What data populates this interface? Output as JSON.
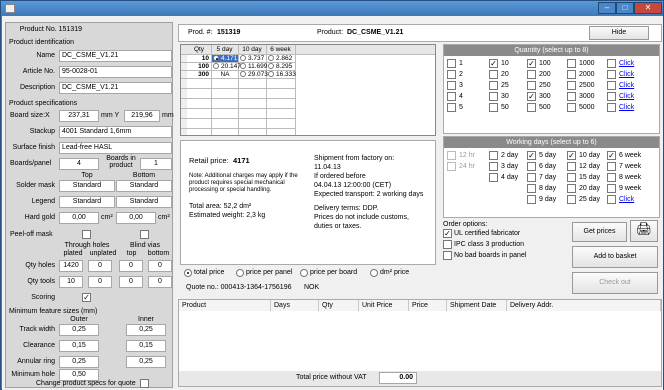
{
  "window": {
    "title": "",
    "min": "–",
    "max": "□",
    "close": "✕"
  },
  "left": {
    "product_no": "Product No. 151319",
    "product_identification": "Product identification",
    "name_label": "Name",
    "name_value": "DC_CSME_V1.21",
    "article_label": "Article No.",
    "article_value": "95-0028-01",
    "description_label": "Description",
    "description_value": "DC_CSME_V1.21",
    "product_specs": "Product specifications",
    "board_size_label": "Board size:X",
    "board_x": "237,31",
    "mm_y": "mm Y",
    "board_y": "219,96",
    "mm": "mm",
    "stackup_label": "Stackup",
    "stackup_value": "4001 Standard 1,6mm",
    "surface_label": "Surface finish",
    "surface_value": "Lead-free HASL",
    "boards_panel_label": "Boards/panel",
    "boards_panel_value": "4",
    "boards_product_label": "Boards in product",
    "boards_product_value": "1",
    "top": "Top",
    "bottom": "Bottom",
    "solder_mask": "Solder mask",
    "solder_top": "Standard",
    "solder_bottom": "Standard",
    "legend": "Legend",
    "legend_top": "Standard",
    "legend_bottom": "Standard",
    "hard_gold": "Hard gold",
    "gold_top": "0,00",
    "gold_bottom": "0,00",
    "cm2": "cm²",
    "peel_off": "Peel-off mask",
    "through_holes": "Through holes",
    "plated": "plated",
    "unplated": "unplated",
    "blind_vias": "Blind vias",
    "b_top": "top",
    "b_bottom": "bottom",
    "qty_holes": "Qty holes",
    "holes_plated": "1420",
    "holes_unplated": "0",
    "holes_top": "0",
    "holes_bottom": "0",
    "qty_tools": "Qty tools",
    "tools_plated": "10",
    "tools_unplated": "0",
    "tools_top": "0",
    "tools_bottom": "0",
    "scoring": "Scoring",
    "scoring_check": "✓",
    "min_feature": "Minimum feature sizes (mm)",
    "outer": "Outer",
    "inner": "Inner",
    "track_width": "Track width",
    "tw_outer": "0,25",
    "tw_inner": "0,25",
    "clearance": "Clearance",
    "cl_outer": "0,15",
    "cl_inner": "0,15",
    "annular": "Annular ring",
    "ar_outer": "0,25",
    "ar_inner": "0,25",
    "min_hole": "Minimum hole",
    "min_hole_value": "0,50",
    "change_specs": "Change product specs for quote"
  },
  "header": {
    "prod_label": "Prod. #:",
    "prod_no": "151319",
    "product_label": "Product:",
    "product_name": "DC_CSME_V1.21",
    "hide": "Hide"
  },
  "grid": {
    "cols": [
      "Qty",
      "5 day",
      "10 day",
      "6 week"
    ],
    "rows": [
      {
        "qty": "10",
        "d5": "4.171",
        "d10": "3.737",
        "w6": "2.862"
      },
      {
        "qty": "100",
        "d5": "20.147",
        "d10": "11.699",
        "w6": "8.295"
      },
      {
        "qty": "300",
        "d5": "NA",
        "d10": "29.073",
        "w6": "16.333"
      }
    ]
  },
  "info": {
    "retail_label": "Retail price:",
    "retail_value": "4171",
    "note": "Note: Additional charges may apply if the product requires special mechanical processing or special handling.",
    "total_area": "Total area: 52,2 dm²",
    "weight": "Estimated weight: 2,3 kg",
    "shipment1": "Shipment from factory on:",
    "shipment2": "11.04.13",
    "shipment3": "If ordered before",
    "shipment4": "04.04.13 12:00:00 (CET)",
    "shipment5": "Expected transport: 2 working days",
    "delivery1": "Delivery terms: DDP.",
    "delivery2": "Prices do not include customs,",
    "delivery3": "duties or taxes."
  },
  "radios": {
    "total": "total price",
    "panel": "price per panel",
    "board": "price per board",
    "dm2": "dm² price",
    "quote_no": "Quote no.: 000413-1364-1756196",
    "nok": "NOK"
  },
  "quantity": {
    "title": "Quantity (select up to 8)",
    "items": [
      {
        "v": "1",
        "c": false
      },
      {
        "v": "10",
        "c": true
      },
      {
        "v": "100",
        "c": true
      },
      {
        "v": "1000",
        "c": false
      },
      {
        "v": "Click",
        "c": false,
        "link": true
      },
      {
        "v": "2",
        "c": false
      },
      {
        "v": "20",
        "c": false
      },
      {
        "v": "200",
        "c": false
      },
      {
        "v": "2000",
        "c": false
      },
      {
        "v": "Click",
        "c": false,
        "link": true
      },
      {
        "v": "3",
        "c": false
      },
      {
        "v": "25",
        "c": false
      },
      {
        "v": "250",
        "c": false
      },
      {
        "v": "2500",
        "c": false
      },
      {
        "v": "Click",
        "c": false,
        "link": true
      },
      {
        "v": "4",
        "c": false
      },
      {
        "v": "30",
        "c": false
      },
      {
        "v": "300",
        "c": true
      },
      {
        "v": "3000",
        "c": false
      },
      {
        "v": "Click",
        "c": false,
        "link": true
      },
      {
        "v": "5",
        "c": false
      },
      {
        "v": "50",
        "c": false
      },
      {
        "v": "500",
        "c": false
      },
      {
        "v": "5000",
        "c": false
      },
      {
        "v": "Click",
        "c": false,
        "link": true
      }
    ]
  },
  "days": {
    "title": "Working days (select up to 6)",
    "items": [
      {
        "v": "12 hr",
        "c": false,
        "dis": true
      },
      {
        "v": "2 day",
        "c": false
      },
      {
        "v": "5 day",
        "c": true
      },
      {
        "v": "10 day",
        "c": true
      },
      {
        "v": "6 week",
        "c": true
      },
      {
        "v": "24 hr",
        "c": false,
        "dis": true
      },
      {
        "v": "3 day",
        "c": false
      },
      {
        "v": "6 day",
        "c": false
      },
      {
        "v": "12 day",
        "c": false
      },
      {
        "v": "7 week",
        "c": false
      },
      {
        "v": "",
        "c": false,
        "blank": true
      },
      {
        "v": "4 day",
        "c": false
      },
      {
        "v": "7 day",
        "c": false
      },
      {
        "v": "15 day",
        "c": false
      },
      {
        "v": "8 week",
        "c": false
      },
      {
        "v": "",
        "blank": true
      },
      {
        "v": "",
        "blank": true
      },
      {
        "v": "8 day",
        "c": false
      },
      {
        "v": "20 day",
        "c": false
      },
      {
        "v": "9 week",
        "c": false
      },
      {
        "v": "",
        "blank": true
      },
      {
        "v": "",
        "blank": true
      },
      {
        "v": "9 day",
        "c": false
      },
      {
        "v": "25 day",
        "c": false
      },
      {
        "v": "Click",
        "c": false,
        "link": true
      }
    ]
  },
  "options": {
    "title": "Order options:",
    "ul": "UL certified fabricator",
    "ipc": "IPC class 3 production",
    "nobad": "No bad boards in panel",
    "get_prices": "Get prices",
    "add_basket": "Add to basket",
    "checkout": "Check out"
  },
  "table": {
    "cols": [
      "Product",
      "Days",
      "Qty",
      "Unit Price",
      "Price",
      "Shipment Date",
      "Delivery Addr."
    ],
    "total_label": "Total price without VAT",
    "total_value": "0.00"
  }
}
